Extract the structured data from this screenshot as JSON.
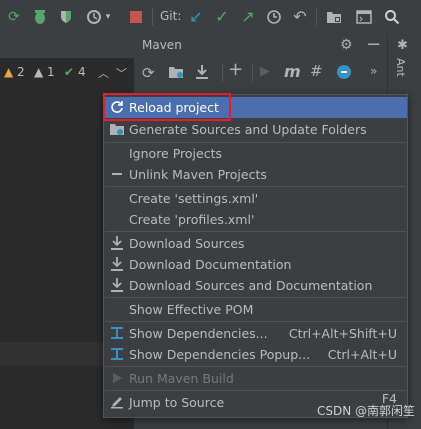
{
  "toolbar": {
    "git_label": "Git:"
  },
  "inspections": {
    "errors": "2",
    "warnings": "1",
    "passes": "4"
  },
  "maven": {
    "title": "Maven"
  },
  "right_strip": {
    "ant_label": "Ant"
  },
  "menu": {
    "items": [
      {
        "label": "Reload project",
        "shortcut": "",
        "icon": "reload-icon",
        "state": "selected"
      },
      {
        "label": "Generate Sources and Update Folders",
        "shortcut": "",
        "icon": "generate-sources-icon",
        "state": "normal"
      },
      {
        "label": "Ignore Projects",
        "shortcut": "",
        "icon": "",
        "state": "normal"
      },
      {
        "label": "Unlink Maven Projects",
        "shortcut": "",
        "icon": "minus-icon",
        "state": "normal"
      },
      {
        "label": "Create 'settings.xml'",
        "shortcut": "",
        "icon": "",
        "state": "normal"
      },
      {
        "label": "Create 'profiles.xml'",
        "shortcut": "",
        "icon": "",
        "state": "normal"
      },
      {
        "label": "Download Sources",
        "shortcut": "",
        "icon": "download-icon",
        "state": "normal"
      },
      {
        "label": "Download Documentation",
        "shortcut": "",
        "icon": "download-icon",
        "state": "normal"
      },
      {
        "label": "Download Sources and Documentation",
        "shortcut": "",
        "icon": "download-icon",
        "state": "normal"
      },
      {
        "label": "Show Effective POM",
        "shortcut": "",
        "icon": "",
        "state": "normal"
      },
      {
        "label": "Show Dependencies...",
        "shortcut": "Ctrl+Alt+Shift+U",
        "icon": "dependencies-icon",
        "state": "normal"
      },
      {
        "label": "Show Dependencies Popup...",
        "shortcut": "Ctrl+Alt+U",
        "icon": "dependencies-icon",
        "state": "normal"
      },
      {
        "label": "Run Maven Build",
        "shortcut": "",
        "icon": "run-icon",
        "state": "disabled"
      },
      {
        "label": "Jump to Source",
        "shortcut": "F4",
        "icon": "edit-icon",
        "state": "normal"
      }
    ]
  },
  "watermark": "CSDN @南郭闲笙",
  "colors": {
    "selection": "#4b6eaf",
    "highlight_box": "#e0202a",
    "menu_bg": "#3c3f41"
  }
}
